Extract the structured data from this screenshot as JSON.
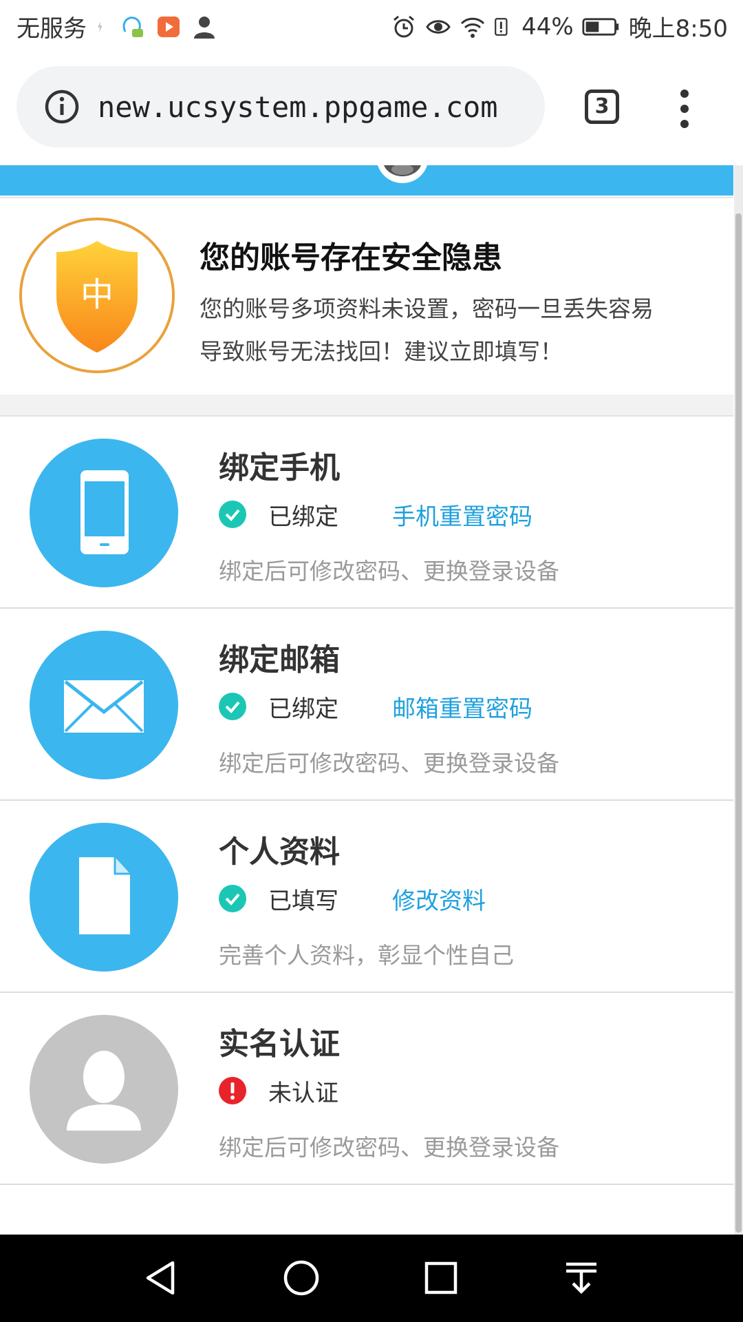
{
  "status_bar": {
    "carrier": "无服务",
    "battery": "44%",
    "time": "晚上8:50"
  },
  "browser": {
    "url": "new.ucsystem.ppgame.com",
    "tab_count": "3"
  },
  "alert": {
    "shield_level": "中",
    "title": "您的账号存在安全隐患",
    "line1": "您的账号多项资料未设置，密码一旦丢失容易",
    "line2": "导致账号无法找回！建议立即填写！"
  },
  "items": [
    {
      "title": "绑定手机",
      "status": "已绑定",
      "action": "手机重置密码",
      "desc": "绑定后可修改密码、更换登录设备"
    },
    {
      "title": "绑定邮箱",
      "status": "已绑定",
      "action": "邮箱重置密码",
      "desc": "绑定后可修改密码、更换登录设备"
    },
    {
      "title": "个人资料",
      "status": "已填写",
      "action": "修改资料",
      "desc": "完善个人资料，彰显个性自己"
    },
    {
      "title": "实名认证",
      "status": "未认证",
      "action": "",
      "desc": "绑定后可修改密码、更换登录设备"
    }
  ],
  "colors": {
    "accent_blue": "#3cb6ee",
    "link_blue": "#1fa0de",
    "ok_teal": "#1bc7b4",
    "warn_red": "#e8232b",
    "disabled_gray": "#c4c4c4"
  }
}
